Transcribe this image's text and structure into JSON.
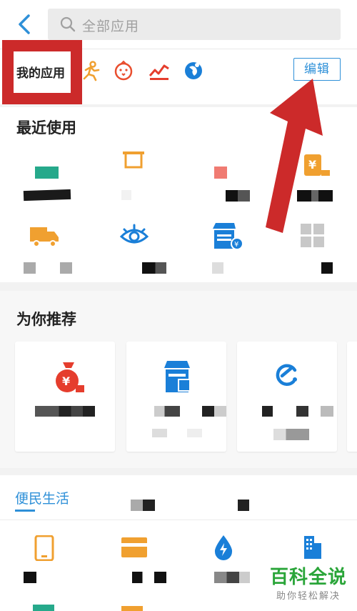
{
  "search": {
    "placeholder": "全部应用"
  },
  "my_apps": {
    "label": "我的应用",
    "edit_label": "编辑"
  },
  "recent": {
    "title": "最近使用"
  },
  "recommend": {
    "title": "为你推荐"
  },
  "bottom": {
    "tab_label": "便民生活"
  },
  "watermark": {
    "title": "百科全说",
    "subtitle": "助你轻松解决"
  },
  "colors": {
    "accent": "#2e90d8",
    "annotation_red": "#cc2a2a",
    "watermark_green": "#2aa539"
  }
}
